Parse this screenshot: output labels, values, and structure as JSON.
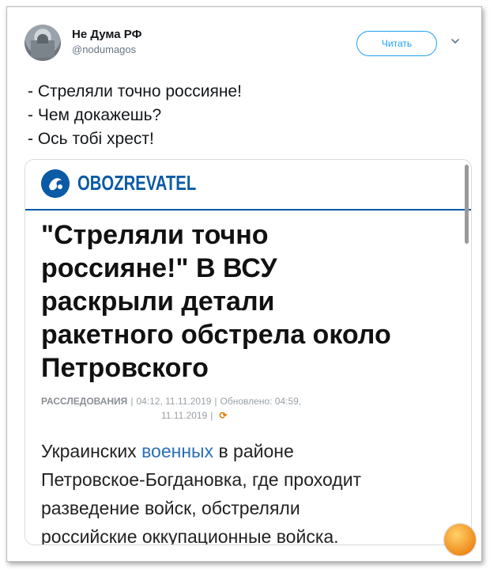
{
  "tweet": {
    "author_name": "Не Дума РФ",
    "author_handle": "@nodumagos",
    "follow_label": "Читать",
    "lines": [
      "- Стреляли точно россияне!",
      "- Чем докажешь?",
      "- Ось тобі хрест!"
    ]
  },
  "card": {
    "brand": "OBOZREVATEL",
    "headline_lines": [
      "\"Стреляли точно",
      "россияне!\" В ВСУ",
      "раскрыли детали",
      "ракетного обстрела около",
      "Петровского"
    ],
    "meta": {
      "category": "РАССЛЕДОВАНИЯ",
      "published": "04:12, 11.11.2019",
      "updated": "Обновлено: 04:59,",
      "updated_date": "11.11.2019"
    },
    "body_lines": [
      [
        "Украинских ",
        "военных",
        " в районе"
      ],
      [
        "Петровское-Богдановка, где проходит"
      ],
      [
        "разведение войск, обстреляли"
      ],
      [
        "российские оккупационные войска."
      ]
    ]
  },
  "colors": {
    "accent_blue": "#1da1f2",
    "brand_blue": "#0b5aa6",
    "link_blue": "#2a6fb5",
    "refresh_orange": "#e07a00"
  },
  "icons": [
    "chevron-down-icon",
    "globe-logo-icon",
    "refresh-icon",
    "watermark-logo-icon"
  ]
}
